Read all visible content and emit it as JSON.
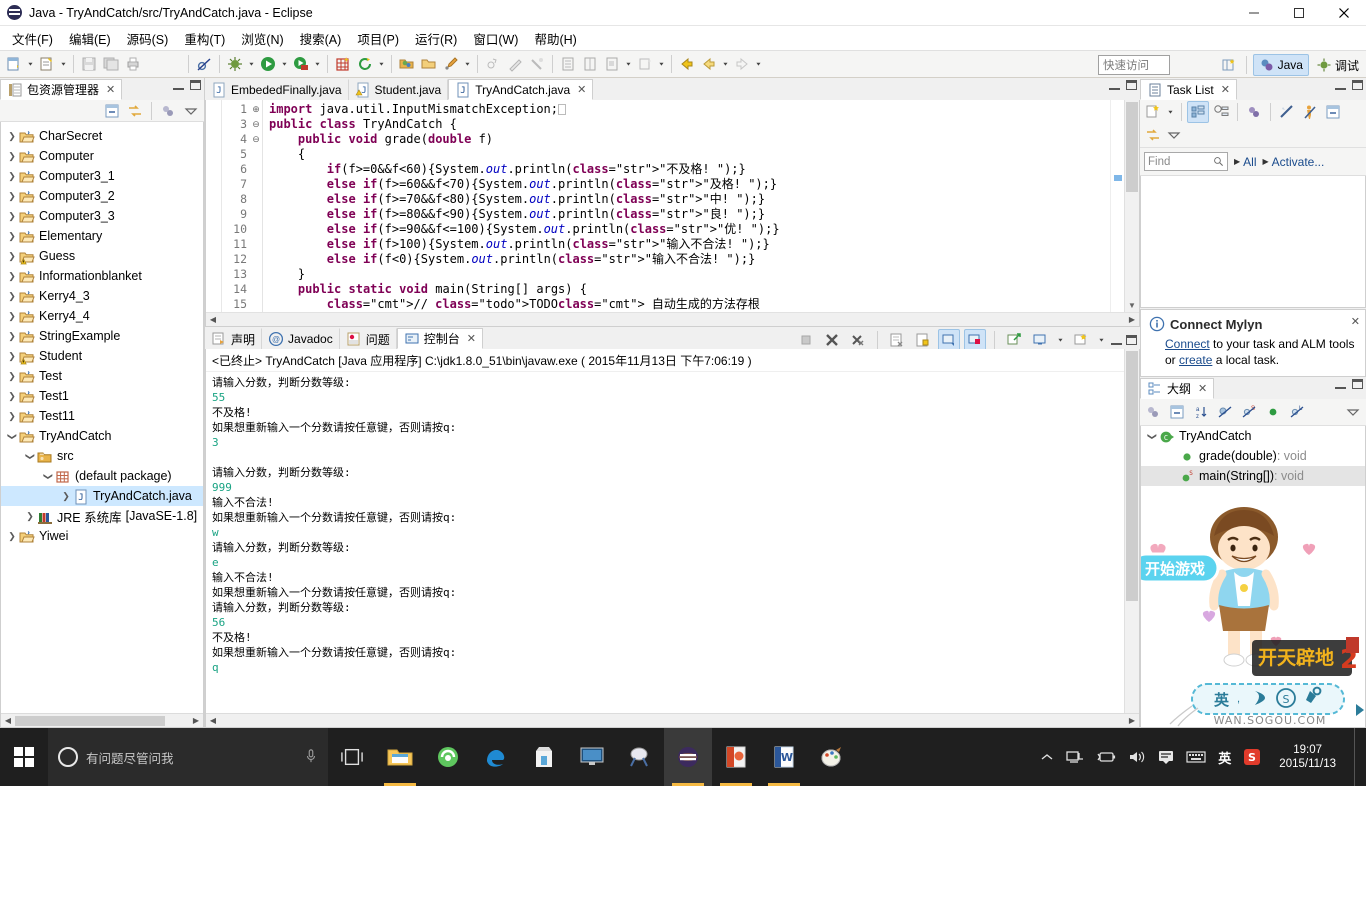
{
  "window": {
    "title": "Java  -  TryAndCatch/src/TryAndCatch.java  -  Eclipse",
    "app_icon": "eclipse-logo-icon",
    "minimize": "─",
    "maximize": "☐",
    "close": "✕"
  },
  "menubar": {
    "items": [
      {
        "label": "文件(F)",
        "name": "menu-file"
      },
      {
        "label": "编辑(E)",
        "name": "menu-edit"
      },
      {
        "label": "源码(S)",
        "name": "menu-source"
      },
      {
        "label": "重构(T)",
        "name": "menu-refactor"
      },
      {
        "label": "浏览(N)",
        "name": "menu-navigate"
      },
      {
        "label": "搜索(A)",
        "name": "menu-search"
      },
      {
        "label": "项目(P)",
        "name": "menu-project"
      },
      {
        "label": "运行(R)",
        "name": "menu-run"
      },
      {
        "label": "窗口(W)",
        "name": "menu-window"
      },
      {
        "label": "帮助(H)",
        "name": "menu-help"
      }
    ]
  },
  "toolbar": {
    "quick_access_placeholder": "快速访问",
    "perspective_java": "Java",
    "perspective_debug": "调试",
    "icons": [
      "new-wizard-icon",
      "new-java-class-icon",
      "save-icon",
      "save-all-icon",
      "print-icon",
      "toggle-breakpoint-icon",
      "debug-icon",
      "run-icon",
      "run-coverage-icon",
      "new-java-project-icon",
      "external-tools-icon",
      "open-type-icon",
      "open-task-icon",
      "search-icon",
      "skip-breakpoints-icon",
      "next-annotation-icon",
      "previous-annotation-icon",
      "toggle-mark-occurrences-icon",
      "show-whitespace-icon",
      "toggle-block-selection-icon",
      "last-edit-location-icon",
      "back-icon",
      "forward-icon"
    ]
  },
  "explorer": {
    "tab_label": "包资源管理器",
    "tab_icon": "package-explorer-icon",
    "toolbar_icons": [
      "collapse-all-icon",
      "link-with-editor-icon",
      "focus-on-active-task-icon",
      "view-menu-icon"
    ],
    "tree": [
      {
        "label": "CharSecret",
        "icon": "java-project-icon",
        "indent": 0,
        "state": "collapsed"
      },
      {
        "label": "Computer",
        "icon": "java-project-icon",
        "indent": 0,
        "state": "collapsed"
      },
      {
        "label": "Computer3_1",
        "icon": "java-project-icon",
        "indent": 0,
        "state": "collapsed"
      },
      {
        "label": "Computer3_2",
        "icon": "java-project-icon",
        "indent": 0,
        "state": "collapsed"
      },
      {
        "label": "Computer3_3",
        "icon": "java-project-icon",
        "indent": 0,
        "state": "collapsed"
      },
      {
        "label": "Elementary",
        "icon": "java-project-icon",
        "indent": 0,
        "state": "collapsed"
      },
      {
        "label": "Guess",
        "icon": "java-project-warning-icon",
        "indent": 0,
        "state": "collapsed"
      },
      {
        "label": "Informationblanket",
        "icon": "java-project-icon",
        "indent": 0,
        "state": "collapsed"
      },
      {
        "label": "Kerry4_3",
        "icon": "java-project-icon",
        "indent": 0,
        "state": "collapsed"
      },
      {
        "label": "Kerry4_4",
        "icon": "java-project-icon",
        "indent": 0,
        "state": "collapsed"
      },
      {
        "label": "StringExample",
        "icon": "java-project-icon",
        "indent": 0,
        "state": "collapsed"
      },
      {
        "label": "Student",
        "icon": "java-project-warning-icon",
        "indent": 0,
        "state": "collapsed"
      },
      {
        "label": "Test",
        "icon": "java-project-icon",
        "indent": 0,
        "state": "collapsed"
      },
      {
        "label": "Test1",
        "icon": "java-project-icon",
        "indent": 0,
        "state": "collapsed"
      },
      {
        "label": "Test11",
        "icon": "java-project-icon",
        "indent": 0,
        "state": "collapsed"
      },
      {
        "label": "TryAndCatch",
        "icon": "java-project-icon",
        "indent": 0,
        "state": "expanded"
      },
      {
        "label": "src",
        "icon": "source-folder-icon",
        "indent": 1,
        "state": "expanded"
      },
      {
        "label": "(default package)",
        "icon": "package-icon",
        "indent": 2,
        "state": "expanded"
      },
      {
        "label": "TryAndCatch.java",
        "icon": "java-file-icon",
        "indent": 3,
        "state": "collapsed",
        "selected": true
      },
      {
        "label": "JRE 系统库",
        "suffix": "[JavaSE-1.8]",
        "icon": "jre-library-icon",
        "indent": 1,
        "state": "collapsed"
      },
      {
        "label": "Yiwei",
        "icon": "java-project-icon",
        "indent": 0,
        "state": "collapsed"
      }
    ]
  },
  "editor": {
    "tabs": [
      {
        "label": "EmbededFinally.java",
        "icon": "java-file-icon",
        "active": false
      },
      {
        "label": "Student.java",
        "icon": "java-file-warning-icon",
        "active": false
      },
      {
        "label": "TryAndCatch.java",
        "icon": "java-file-icon",
        "active": true
      }
    ],
    "close_glyph": "✕",
    "lines": [
      {
        "no": "1",
        "fold": "⊕",
        "text": "import java.util.InputMismatchException;"
      },
      {
        "no": "3",
        "fold": "",
        "text": "public class TryAndCatch {"
      },
      {
        "no": "4",
        "fold": "⊖",
        "text": "    public void grade(double f)"
      },
      {
        "no": "5",
        "fold": "",
        "text": "    {"
      },
      {
        "no": "6",
        "fold": "",
        "text": "        if(f>=0&&f<60){System.out.println(\"不及格! \");}"
      },
      {
        "no": "7",
        "fold": "",
        "text": "        else if(f>=60&&f<70){System.out.println(\"及格! \");}"
      },
      {
        "no": "8",
        "fold": "",
        "text": "        else if(f>=70&&f<80){System.out.println(\"中! \");}"
      },
      {
        "no": "9",
        "fold": "",
        "text": "        else if(f>=80&&f<90){System.out.println(\"良! \");}"
      },
      {
        "no": "10",
        "fold": "",
        "text": "        else if(f>=90&&f<=100){System.out.println(\"优! \");}"
      },
      {
        "no": "11",
        "fold": "",
        "text": "        else if(f>100){System.out.println(\"输入不合法! \");}"
      },
      {
        "no": "12",
        "fold": "",
        "text": "        else if(f<0){System.out.println(\"输入不合法! \");}"
      },
      {
        "no": "13",
        "fold": "",
        "text": "    }"
      },
      {
        "no": "14",
        "fold": "⊖",
        "text": "    public static void main(String[] args) {"
      },
      {
        "no": "15",
        "fold": "",
        "text": "        // TODO 自动生成的方法存根"
      }
    ]
  },
  "console": {
    "tabs": [
      {
        "label": "声明",
        "icon": "declaration-icon",
        "active": false
      },
      {
        "label": "Javadoc",
        "icon": "javadoc-icon",
        "active": false
      },
      {
        "label": "问题",
        "icon": "problems-icon",
        "active": false
      },
      {
        "label": "控制台",
        "icon": "console-icon",
        "active": true
      }
    ],
    "close_glyph": "✕",
    "toolbar_icons": [
      "terminate-all-icon",
      "remove-launch-icon",
      "remove-all-terminated-icon",
      "clear-console-icon",
      "scroll-lock-icon",
      "show-console-on-output-icon",
      "show-console-on-error-icon",
      "pin-console-icon",
      "display-selected-console-icon",
      "open-console-icon",
      "minimize-icon",
      "maximize-icon"
    ],
    "header": "<已终止> TryAndCatch [Java 应用程序] C:\\jdk1.8.0_51\\bin\\javaw.exe ( 2015年11月13日 下午7:06:19 )",
    "output": [
      {
        "text": "请输入分数，判断分数等级:",
        "type": "out"
      },
      {
        "text": "55",
        "type": "in"
      },
      {
        "text": "不及格!",
        "type": "out"
      },
      {
        "text": "如果想重新输入一个分数请按任意键，否则请按q:",
        "type": "out"
      },
      {
        "text": "3",
        "type": "in"
      },
      {
        "text": "",
        "type": "out"
      },
      {
        "text": "请输入分数，判断分数等级:",
        "type": "out"
      },
      {
        "text": "999",
        "type": "in"
      },
      {
        "text": "输入不合法!",
        "type": "out"
      },
      {
        "text": "如果想重新输入一个分数请按任意键，否则请按q:",
        "type": "out"
      },
      {
        "text": "w",
        "type": "in"
      },
      {
        "text": "请输入分数，判断分数等级:",
        "type": "out"
      },
      {
        "text": "e",
        "type": "in"
      },
      {
        "text": "输入不合法!",
        "type": "out"
      },
      {
        "text": "如果想重新输入一个分数请按任意键，否则请按q:",
        "type": "out"
      },
      {
        "text": "请输入分数，判断分数等级:",
        "type": "out"
      },
      {
        "text": "56",
        "type": "in"
      },
      {
        "text": "不及格!",
        "type": "out"
      },
      {
        "text": "如果想重新输入一个分数请按任意键，否则请按q:",
        "type": "out"
      },
      {
        "text": "q",
        "type": "in"
      }
    ]
  },
  "tasklist": {
    "tab_label": "Task List",
    "tab_icon": "task-list-icon",
    "toolbar_icons": [
      "new-task-icon",
      "new-task-dropdown-icon",
      "categorized-mode-icon",
      "scheduled-mode-icon",
      "synchronize-icon",
      "focus-on-workweek-icon",
      "activate-task-icon",
      "collapse-all-icon",
      "link-with-editor-icon",
      "view-menu-icon"
    ],
    "find_placeholder": "Find",
    "search_icon": "search-icon",
    "filter_all": "All",
    "filter_activate": "Activate..."
  },
  "mylyn": {
    "title": "Connect Mylyn",
    "info_icon": "info-icon",
    "close_glyph": "✕",
    "body_prefix": "",
    "link_connect": "Connect",
    "body_mid": " to your task and ALM tools or ",
    "link_create": "create",
    "body_suffix": " a local task."
  },
  "outline": {
    "tab_label": "大纲",
    "tab_icon": "outline-icon",
    "toolbar_icons": [
      "focus-on-active-task-icon",
      "collapse-all-icon",
      "sort-icon",
      "hide-fields-icon",
      "hide-static-icon",
      "hide-non-public-icon",
      "hide-local-types-icon",
      "view-menu-icon"
    ],
    "items": [
      {
        "label": "TryAndCatch",
        "icon": "class-icon",
        "indent": 0,
        "state": "expanded",
        "selected": false
      },
      {
        "label": "grade(double)",
        "ret": " : void",
        "icon": "public-method-icon",
        "indent": 1,
        "state": "leaf",
        "selected": false
      },
      {
        "label": "main(String[])",
        "ret": " : void",
        "icon": "public-static-method-icon",
        "indent": 1,
        "state": "leaf",
        "selected": true
      }
    ]
  },
  "ad": {
    "button_label": "开始游戏",
    "game_title": "开天辟地 2",
    "brand": "WAN.SOGOU.COM",
    "ime_lang": "英",
    "name": "sogou-game-ad"
  },
  "taskbar": {
    "start_icon": "windows-start-icon",
    "cortana_placeholder": "有问题尽管问我",
    "cortana_ring_icon": "cortana-circle-icon",
    "mic_icon": "microphone-icon",
    "task_view_icon": "task-view-icon",
    "apps": [
      {
        "name": "file-explorer-icon",
        "running": true
      },
      {
        "name": "360-browser-icon",
        "running": false
      },
      {
        "name": "edge-browser-icon",
        "running": false
      },
      {
        "name": "microsoft-store-icon",
        "running": false
      },
      {
        "name": "remote-desktop-icon",
        "running": false
      },
      {
        "name": "snipping-tool-icon",
        "running": false
      },
      {
        "name": "eclipse-icon",
        "running": true,
        "active": true
      },
      {
        "name": "powerpoint-icon",
        "running": true
      },
      {
        "name": "word-icon",
        "running": true
      },
      {
        "name": "paint-icon",
        "running": false
      }
    ],
    "tray": [
      {
        "name": "show-hidden-icons-icon",
        "glyph": "∧"
      },
      {
        "name": "network-icon",
        "glyph": ""
      },
      {
        "name": "battery-icon",
        "glyph": ""
      },
      {
        "name": "volume-icon",
        "glyph": ""
      },
      {
        "name": "action-center-icon",
        "glyph": ""
      },
      {
        "name": "keyboard-icon",
        "glyph": ""
      },
      {
        "name": "ime-english-icon",
        "glyph": "英"
      },
      {
        "name": "sogou-ime-icon",
        "glyph": "S"
      }
    ],
    "clock_time": "19:07",
    "clock_date": "2015/11/13"
  },
  "colors": {
    "accent": "#1a4b8c",
    "tab_active_bg": "#ffffff",
    "selection": "#cde8ff",
    "console_input": "#19a383",
    "keyword": "#7f0055",
    "string": "#2a00ff",
    "comment": "#3f7f5f"
  }
}
